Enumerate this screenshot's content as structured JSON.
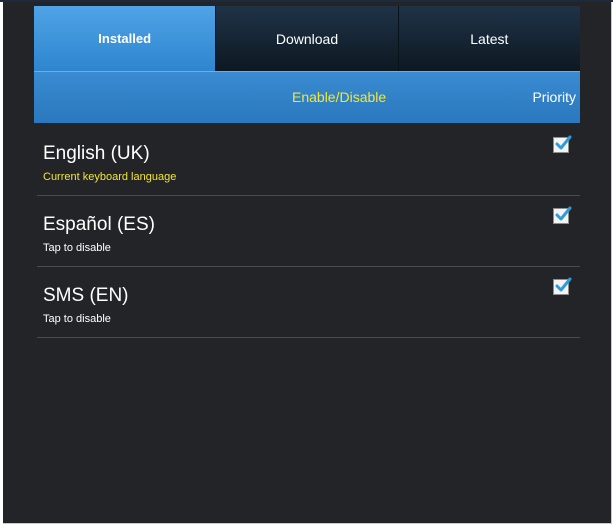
{
  "tabs": [
    {
      "label": "Installed",
      "active": true
    },
    {
      "label": "Download",
      "active": false
    },
    {
      "label": "Latest",
      "active": false
    }
  ],
  "subheader": {
    "enable_label": "Enable/Disable",
    "priority_label": "Priority"
  },
  "languages": [
    {
      "name": "English (UK)",
      "status": "Current keyboard language",
      "checked": true
    },
    {
      "name": "Español (ES)",
      "status": "Tap to disable",
      "checked": true
    },
    {
      "name": "SMS (EN)",
      "status": "Tap to disable",
      "checked": true
    }
  ],
  "colors": {
    "accent_blue": "#3a8bd2",
    "highlight_yellow": "#f3e634",
    "background": "#232428",
    "check_color": "#2f9bd8"
  },
  "icons": {
    "checkbox": "checkmark-icon"
  }
}
